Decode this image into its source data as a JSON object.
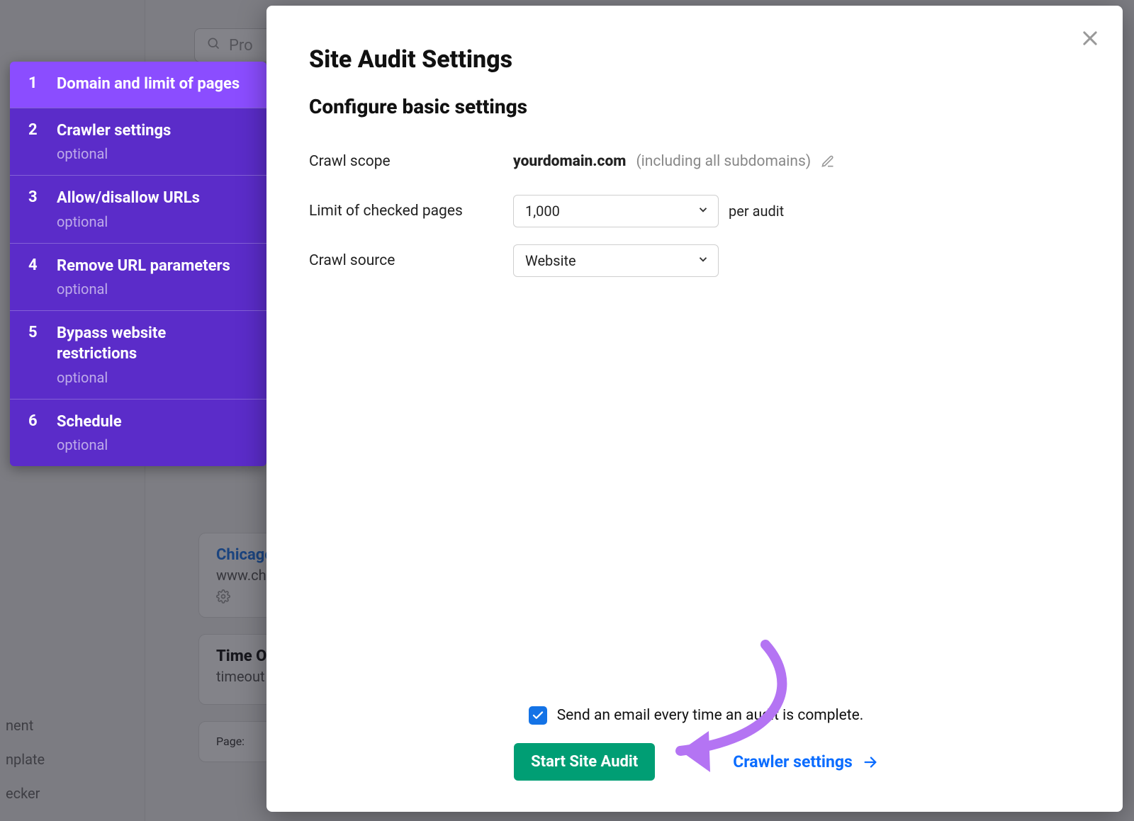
{
  "background": {
    "search_prefix": "Pro",
    "left_items": [
      "nent",
      "nplate",
      "ecker"
    ],
    "card1": {
      "title": "Chicago",
      "sub": "www.ch"
    },
    "card2": {
      "title": "Time O",
      "sub": "timeout"
    },
    "card3": {
      "label": "Page:"
    }
  },
  "wizard": {
    "steps": [
      {
        "num": "1",
        "title": "Domain and limit of pages",
        "optional": ""
      },
      {
        "num": "2",
        "title": "Crawler settings",
        "optional": "optional"
      },
      {
        "num": "3",
        "title": "Allow/disallow URLs",
        "optional": "optional"
      },
      {
        "num": "4",
        "title": "Remove URL parameters",
        "optional": "optional"
      },
      {
        "num": "5",
        "title": "Bypass website restrictions",
        "optional": "optional"
      },
      {
        "num": "6",
        "title": "Schedule",
        "optional": "optional"
      }
    ]
  },
  "modal": {
    "title": "Site Audit Settings",
    "subtitle": "Configure basic settings",
    "rows": {
      "scope_label": "Crawl scope",
      "scope_domain": "yourdomain.com",
      "scope_hint": "(including all subdomains)",
      "limit_label": "Limit of checked pages",
      "limit_value": "1,000",
      "limit_after": "per audit",
      "source_label": "Crawl source",
      "source_value": "Website"
    },
    "footer": {
      "checkbox_label": "Send an email every time an audit is complete.",
      "primary": "Start Site Audit",
      "link": "Crawler settings"
    }
  }
}
